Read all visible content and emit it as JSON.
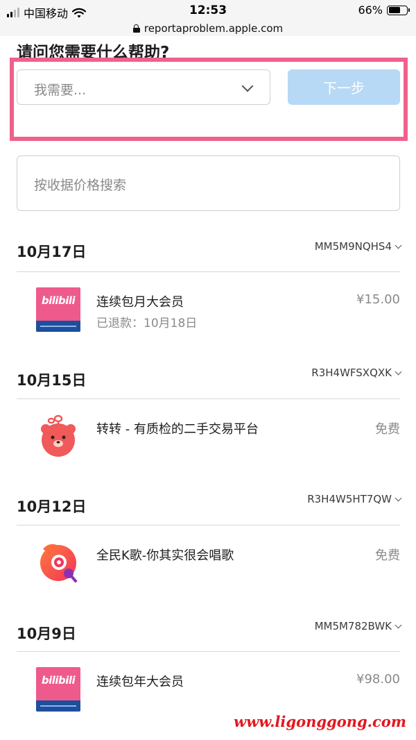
{
  "status_bar": {
    "carrier": "中国移动",
    "time": "12:53",
    "battery": "66%",
    "battery_level": 0.66
  },
  "browser": {
    "url": "reportaproblem.apple.com"
  },
  "page": {
    "title": "请问您需要什么帮助?",
    "select_placeholder": "我需要...",
    "next_label": "下一步",
    "search_placeholder": "按收据价格搜索"
  },
  "colors": {
    "highlight": "#f0608c",
    "next_button": "#b7d9f5"
  },
  "groups": [
    {
      "date": "10月17日",
      "order": "MM5M9NQHS4",
      "item": {
        "icon": "bilibili-icon",
        "title": "连续包月大会员",
        "subtitle": "已退款：10月18日",
        "price": "¥15.00"
      }
    },
    {
      "date": "10月15日",
      "order": "R3H4WFSXQXK",
      "item": {
        "icon": "zhuanzhuan-icon",
        "title": "转转 - 有质检的二手交易平台",
        "price": "免费"
      }
    },
    {
      "date": "10月12日",
      "order": "R3H4W5HT7QW",
      "item": {
        "icon": "quanmin-kge-icon",
        "title": "全民K歌-你其实很会唱歌",
        "price": "免费"
      }
    },
    {
      "date": "10月9日",
      "order": "MM5M782BWK",
      "item": {
        "icon": "bilibili-icon",
        "title": "连续包年大会员",
        "price": "¥98.00"
      }
    }
  ],
  "watermark": "www.ligonggong.com"
}
